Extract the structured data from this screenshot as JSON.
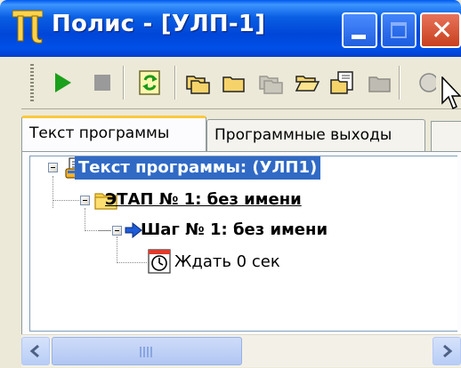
{
  "window": {
    "title": "Полис - [УЛП-1]",
    "titlebar_color": "#0A5FE3",
    "app_icon": "pi-icon"
  },
  "toolbar": {
    "items": [
      "play-icon",
      "stop-icon",
      "refresh-icon",
      "copy-folder-icon",
      "folder-icon",
      "folder-disabled-icon",
      "open-folder-icon",
      "document-icon",
      "folder-gray-icon"
    ]
  },
  "tabs": {
    "active": "Текст программы",
    "inactive": "Программные выходы"
  },
  "tree": {
    "root": "Текст программы:  (УЛП1)",
    "stage": "ЭТАП № 1: без имени",
    "step": "Шаг № 1: без имени",
    "action": "Ждать 0 сек",
    "selected_color": "#316AC5"
  },
  "scrollbar": {
    "orientation": "horizontal"
  }
}
